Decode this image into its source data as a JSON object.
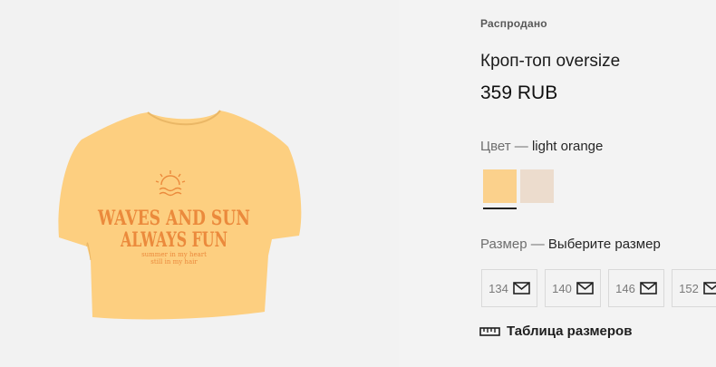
{
  "product": {
    "badge": "Распродано",
    "title": "Кроп-топ oversize",
    "price": "359 RUB"
  },
  "image": {
    "print_line1": "WAVES AND SUN",
    "print_line2": "ALWAYS FUN",
    "print_small1": "summer in my heart",
    "print_small2": "still in my hair"
  },
  "color": {
    "label": "Цвет —",
    "selected": "light orange",
    "swatches": [
      {
        "hex": "#fbd18c",
        "selected": true
      },
      {
        "hex": "#ecdccd",
        "selected": false
      }
    ]
  },
  "size": {
    "label": "Размер —",
    "prompt": "Выберите размер",
    "options": [
      "134",
      "140",
      "146",
      "152"
    ],
    "icon": "envelope-icon"
  },
  "size_table": {
    "label": "Таблица размеров",
    "icon": "ruler-icon"
  },
  "colors": {
    "shirt": "#fdcf80",
    "print": "#eb8a3c",
    "panel_bg": "#f3f3f3"
  }
}
